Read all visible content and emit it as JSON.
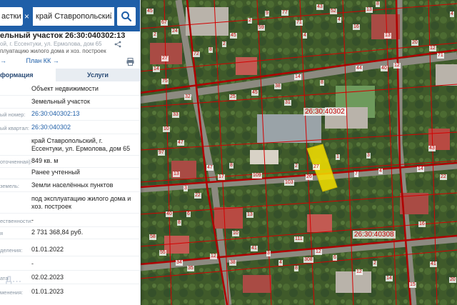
{
  "search": {
    "tab_label": "астки",
    "clear_icon": "×",
    "query": "край Ставропольский, г. Е",
    "search_icon": "search-icon"
  },
  "object": {
    "title": "ельный участок 26:30:040302:13",
    "address_short": "ой, г. Ессентуки, ул. Ермолова, дом 65",
    "purpose_short": "плуатацию жилого дома и хоз. построек",
    "link_1": "→",
    "link_plan": "План КК",
    "link_plan_arrow": "→"
  },
  "tabs": {
    "info": "формация",
    "services": "Услуги"
  },
  "rows": [
    {
      "label": "",
      "value": "Объект недвижимости",
      "link": false
    },
    {
      "label": "",
      "value": "Земельный участок",
      "link": false
    },
    {
      "label": "ый номер:",
      "value": "26:30:040302:13",
      "link": true
    },
    {
      "label": "ый квартал:",
      "value": "26:30:040302",
      "link": true
    },
    {
      "label": "",
      "value": "край Ставропольский, г.",
      "link": false
    },
    {
      "label": "",
      "value": "Ессентуки, ул. Ермолова, дом 65",
      "link": false
    },
    {
      "label": "оточненная):",
      "value": "849 кв. м",
      "link": false
    },
    {
      "label": "",
      "value": "Ранее учтенный",
      "link": false
    },
    {
      "label": "земель:",
      "value": "Земли населённых пунктов",
      "link": false
    },
    {
      "label": "",
      "value": "под эксплуатацию жилого дома и",
      "link": false
    },
    {
      "label": "",
      "value": "хоз. построек",
      "link": false
    },
    {
      "label": "ественности:",
      "value": "-",
      "link": false
    },
    {
      "label": "я",
      "value": "2 731 368,84 руб.",
      "link": false
    },
    {
      "label": "деления:",
      "value": "01.01.2022",
      "link": false
    },
    {
      "label": "",
      "value": "-",
      "link": false
    },
    {
      "label": "ата",
      "value": "02.02.2023",
      "link": false
    },
    {
      "label": "менения:",
      "value": "01.01.2023",
      "link": false
    }
  ],
  "map": {
    "quarter_label_1": "26:30:40302",
    "quarter_label_2": "26:30:40308",
    "parcel_highlight_color": "#f5e000",
    "boundary_color": "#d40000",
    "numbers": [
      "45",
      "67",
      "2",
      "24",
      "27",
      "14",
      "75",
      "72",
      "8",
      "2",
      "45",
      "2",
      "59",
      "9",
      "77",
      "71",
      "4",
      "43",
      "52",
      "4",
      "16",
      "13",
      "8",
      "13",
      "20",
      "12",
      "12",
      "40",
      "71",
      "4",
      "44",
      "8",
      "14",
      "38",
      "31",
      "45",
      "25",
      "32",
      "33",
      "10",
      "47",
      "97",
      "13",
      "3",
      "22",
      "47",
      "17",
      "8",
      "109",
      "103",
      "2",
      "26",
      "27",
      "1",
      "7",
      "3",
      "4",
      "14",
      "22",
      "43",
      "308",
      "111",
      "13",
      "10",
      "6",
      "8",
      "40",
      "58",
      "55",
      "34",
      "35",
      "12",
      "38",
      "41",
      "3",
      "4",
      "8",
      "12",
      "6",
      "12",
      "2",
      "14",
      "15",
      "41",
      "20",
      "16"
    ]
  },
  "watermark": "Д..."
}
